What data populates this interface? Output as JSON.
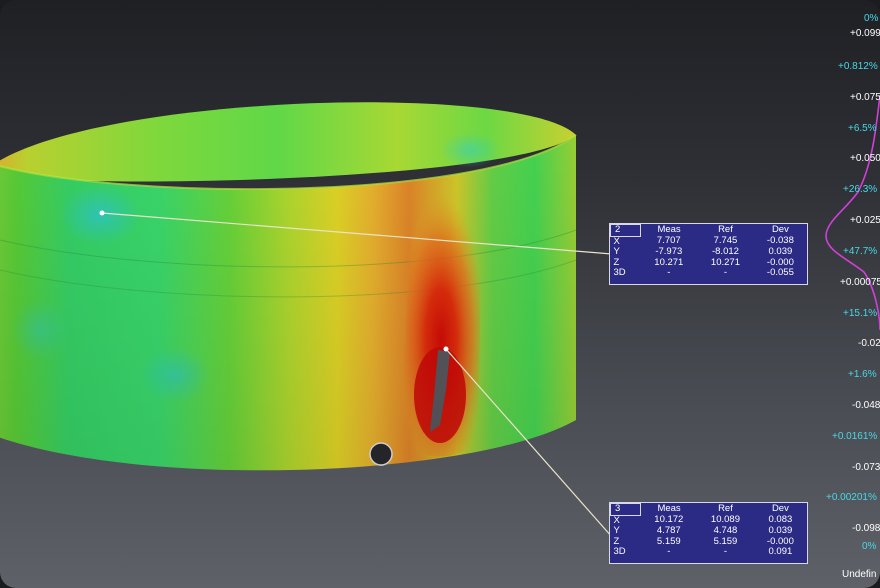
{
  "callouts": [
    {
      "id": "2",
      "headers": [
        "Meas",
        "Ref",
        "Dev"
      ],
      "rows": [
        {
          "label": "X",
          "meas": "7.707",
          "ref": "7.745",
          "dev": "-0.038"
        },
        {
          "label": "Y",
          "meas": "-7.973",
          "ref": "-8.012",
          "dev": "0.039"
        },
        {
          "label": "Z",
          "meas": "10.271",
          "ref": "10.271",
          "dev": "-0.000"
        },
        {
          "label": "3D",
          "meas": "-",
          "ref": "-",
          "dev": "-0.055"
        }
      ]
    },
    {
      "id": "3",
      "headers": [
        "Meas",
        "Ref",
        "Dev"
      ],
      "rows": [
        {
          "label": "X",
          "meas": "10.172",
          "ref": "10.089",
          "dev": "0.083"
        },
        {
          "label": "Y",
          "meas": "4.787",
          "ref": "4.748",
          "dev": "0.039"
        },
        {
          "label": "Z",
          "meas": "5.159",
          "ref": "5.159",
          "dev": "-0.000"
        },
        {
          "label": "3D",
          "meas": "-",
          "ref": "-",
          "dev": "0.091"
        }
      ]
    }
  ],
  "legend": {
    "values": [
      "+0.099",
      "+0.075",
      "+0.050",
      "+0.025",
      "+0.00075",
      "-0.02",
      "-0.048",
      "-0.073",
      "-0.098"
    ],
    "percents": [
      "0%",
      "+0.812%",
      "+6.5%",
      "+26.3%",
      "+47.7%",
      "+15.1%",
      "+1.6%",
      "+0.0161%",
      "+0.00201%",
      "0%"
    ],
    "undefined_label": "Undefin",
    "pct_color": "#48d8e8",
    "val_color": "#ffffff",
    "histogram_color": "#d040d8"
  },
  "colors": {
    "callout_bg": "#2b2b86",
    "leader_line": "#e8e4c8"
  }
}
